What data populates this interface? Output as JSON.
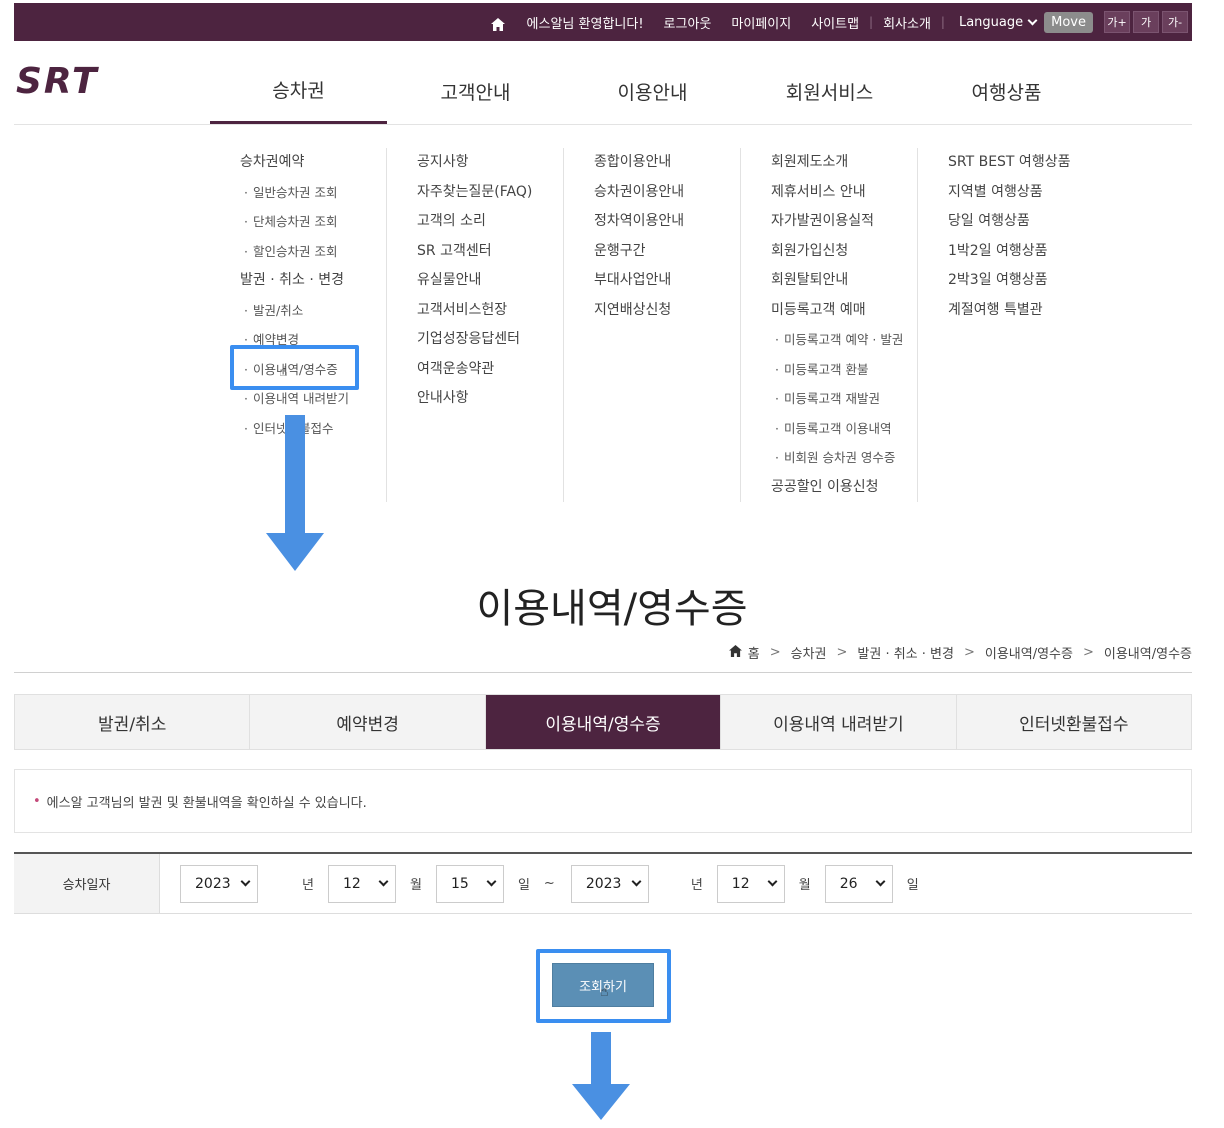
{
  "topbar": {
    "welcome": "에스알님 환영합니다!",
    "logout": "로그아웃",
    "mypage": "마이페이지",
    "sitemap": "사이트맵",
    "company": "회사소개",
    "language": "Language",
    "move": "Move",
    "font_up": "가+",
    "font_normal": "가",
    "font_down": "가-"
  },
  "logo": "SRT",
  "gnb": [
    "승차권",
    "고객안내",
    "이용안내",
    "회원서비스",
    "여행상품"
  ],
  "mega_menu": [
    [
      {
        "label": "승차권예약",
        "sub": false
      },
      {
        "label": "일반승차권 조회",
        "sub": true
      },
      {
        "label": "단체승차권 조회",
        "sub": true
      },
      {
        "label": "할인승차권 조회",
        "sub": true
      },
      {
        "label": "발권 · 취소 · 변경",
        "sub": false
      },
      {
        "label": "발권/취소",
        "sub": true
      },
      {
        "label": "예약변경",
        "sub": true
      },
      {
        "label": "이용내역/영수증",
        "sub": true
      },
      {
        "label": "이용내역 내려받기",
        "sub": true
      },
      {
        "label": "인터넷환불접수",
        "sub": true
      }
    ],
    [
      {
        "label": "공지사항",
        "sub": false
      },
      {
        "label": "자주찾는질문(FAQ)",
        "sub": false
      },
      {
        "label": "고객의 소리",
        "sub": false
      },
      {
        "label": "SR 고객센터",
        "sub": false
      },
      {
        "label": "유실물안내",
        "sub": false
      },
      {
        "label": "고객서비스헌장",
        "sub": false
      },
      {
        "label": "기업성장응답센터",
        "sub": false
      },
      {
        "label": "여객운송약관",
        "sub": false
      },
      {
        "label": "안내사항",
        "sub": false
      }
    ],
    [
      {
        "label": "종합이용안내",
        "sub": false
      },
      {
        "label": "승차권이용안내",
        "sub": false
      },
      {
        "label": "정차역이용안내",
        "sub": false
      },
      {
        "label": "운행구간",
        "sub": false
      },
      {
        "label": "부대사업안내",
        "sub": false
      },
      {
        "label": "지연배상신청",
        "sub": false
      }
    ],
    [
      {
        "label": "회원제도소개",
        "sub": false
      },
      {
        "label": "제휴서비스 안내",
        "sub": false
      },
      {
        "label": "자가발권이용실적",
        "sub": false
      },
      {
        "label": "회원가입신청",
        "sub": false
      },
      {
        "label": "회원탈퇴안내",
        "sub": false
      },
      {
        "label": "미등록고객 예매",
        "sub": false
      },
      {
        "label": "미등록고객 예약 · 발권",
        "sub": true
      },
      {
        "label": "미등록고객 환불",
        "sub": true
      },
      {
        "label": "미등록고객 재발권",
        "sub": true
      },
      {
        "label": "미등록고객 이용내역",
        "sub": true
      },
      {
        "label": "비회원 승차권 영수증",
        "sub": true
      },
      {
        "label": "공공할인 이용신청",
        "sub": false
      }
    ],
    [
      {
        "label": "SRT BEST 여행상품",
        "sub": false
      },
      {
        "label": "지역별 여행상품",
        "sub": false
      },
      {
        "label": "당일 여행상품",
        "sub": false
      },
      {
        "label": "1박2일 여행상품",
        "sub": false
      },
      {
        "label": "2박3일 여행상품",
        "sub": false
      },
      {
        "label": "계절여행 특별관",
        "sub": false
      }
    ]
  ],
  "page": {
    "title": "이용내역/영수증",
    "breadcrumb": [
      "홈",
      "승차권",
      "발권 · 취소 · 변경",
      "이용내역/영수증",
      "이용내역/영수증"
    ]
  },
  "tabs": [
    "발권/취소",
    "예약변경",
    "이용내역/영수증",
    "이용내역 내려받기",
    "인터넷환불접수"
  ],
  "notice": "에스알 고객님의 발권 및 환불내역을 확인하실 수 있습니다.",
  "search": {
    "label": "승차일자",
    "from_year": "2023",
    "from_month": "12",
    "from_day": "15",
    "to_year": "2023",
    "to_month": "12",
    "to_day": "26",
    "unit_year": "년",
    "unit_month": "월",
    "unit_day": "일",
    "range_sep": "~",
    "button": "조회하기"
  },
  "colors": {
    "brand": "#4d2440",
    "highlight": "#3a8ef0",
    "arrow": "#4a90e2",
    "search_button": "#5b8fb5"
  }
}
